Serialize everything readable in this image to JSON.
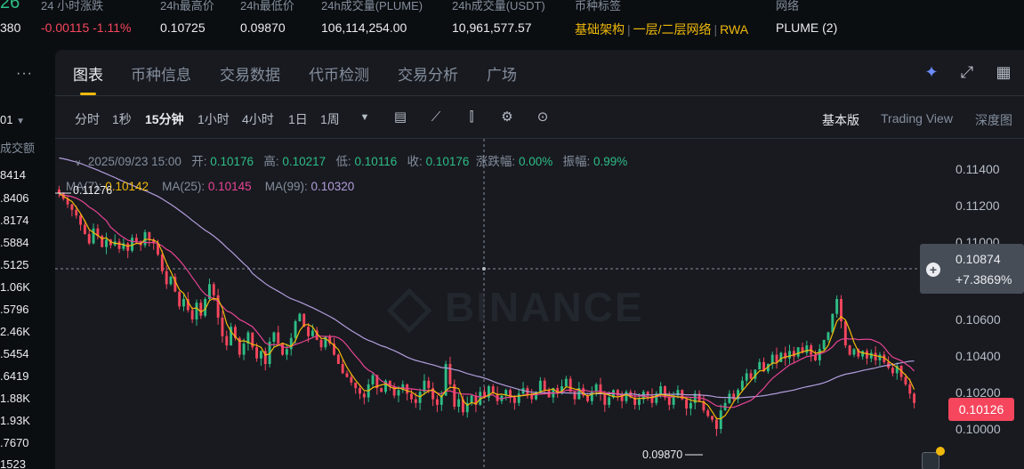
{
  "stats": {
    "price_partial": "380",
    "price_big": "26",
    "change_24h": {
      "label": "24 小时涨跌",
      "value": "-0.00115 -1.11%"
    },
    "high_24h": {
      "label": "24h最高价",
      "value": "0.10725"
    },
    "low_24h": {
      "label": "24h最低价",
      "value": "0.09870"
    },
    "vol_plume": {
      "label": "24h成交量(PLUME)",
      "value": "106,114,254.00"
    },
    "vol_usdt": {
      "label": "24h成交量(USDT)",
      "value": "10,961,577.57"
    },
    "tags": {
      "label": "币种标签",
      "items": [
        "基础架构",
        "一层/二层网络",
        "RWA"
      ]
    },
    "network": {
      "label": "网络",
      "value": "PLUME (2)"
    }
  },
  "left": {
    "dots": "···",
    "pair": "01",
    "header": "成交额",
    "rows": [
      "8414",
      ".8406",
      ".8174",
      ".5884",
      ".5125",
      "1.06K",
      ".5796",
      "2.46K",
      ".5454",
      ".6419",
      "1.88K",
      "1.93K",
      ".7670",
      "1523"
    ]
  },
  "tabs": [
    "图表",
    "币种信息",
    "交易数据",
    "代币检测",
    "交易分析",
    "广场"
  ],
  "toolbar": {
    "intervals": [
      "分时",
      "1秒",
      "15分钟",
      "1小时",
      "4小时",
      "1日",
      "1周"
    ],
    "active_interval": "15分钟",
    "views": [
      "基本版",
      "Trading View",
      "深度图"
    ]
  },
  "icons": {
    "ai": "sparkle-icon",
    "expand": "expand-icon",
    "layout": "grid-icon"
  },
  "info": {
    "date": "2025/09/23 15:00",
    "open_label": "开:",
    "open": "0.10176",
    "high_label": "高:",
    "high": "0.10217",
    "low_label": "低:",
    "low": "0.10116",
    "close_label": "收:",
    "close": "0.10176",
    "change_label": "涨跌幅:",
    "change": "0.00%",
    "amp_label": "振幅:",
    "amp": "0.99%",
    "ma7_label": "MA(7):",
    "ma7": "0.10142",
    "ma25_label": "MA(25):",
    "ma25": "0.10145",
    "ma99_label": "MA(99):",
    "ma99": "0.10320"
  },
  "chart_data": {
    "type": "candlestick",
    "y_axis_labels": [
      "0.11400",
      "0.11200",
      "0.11000",
      "0.10600",
      "0.10400",
      "0.10200",
      "0.10000"
    ],
    "ylim": [
      0.0985,
      0.115
    ],
    "crosshair_price": "0.10874",
    "crosshair_pct": "+7.3869%",
    "last_price": "0.10126",
    "high_marker": "0.11276",
    "low_marker": "0.09870",
    "watermark": "BINANCE",
    "colors": {
      "up": "#2ebd85",
      "down": "#f6465d",
      "ma7": "#f0b90b",
      "ma25": "#e84393",
      "ma99": "#b39ddb"
    },
    "close_path": [
      0.1127,
      0.1124,
      0.1121,
      0.1118,
      0.1115,
      0.111,
      0.1105,
      0.11,
      0.1108,
      0.1104,
      0.1098,
      0.1102,
      0.1099,
      0.1101,
      0.1097,
      0.11,
      0.1096,
      0.1103,
      0.1101,
      0.1099,
      0.1106,
      0.1102,
      0.11,
      0.1094,
      0.1085,
      0.1078,
      0.1082,
      0.1074,
      0.1066,
      0.107,
      0.1064,
      0.1059,
      0.1068,
      0.1061,
      0.107,
      0.1078,
      0.1072,
      0.106,
      0.105,
      0.1045,
      0.1055,
      0.1049,
      0.104,
      0.1046,
      0.1052,
      0.1044,
      0.1038,
      0.1042,
      0.1035,
      0.1047,
      0.1052,
      0.1046,
      0.104,
      0.1043,
      0.1049,
      0.1058,
      0.1062,
      0.1055,
      0.105,
      0.1053,
      0.1048,
      0.1044,
      0.105,
      0.1046,
      0.104,
      0.1035,
      0.103,
      0.1028,
      0.1025,
      0.1022,
      0.1019,
      0.1017,
      0.1024,
      0.1029,
      0.1022,
      0.102,
      0.1026,
      0.1023,
      0.1018,
      0.1021,
      0.1024,
      0.1019,
      0.1016,
      0.1014,
      0.102,
      0.1026,
      0.1022,
      0.1016,
      0.1013,
      0.1018,
      0.1035,
      0.1024,
      0.1012,
      0.1016,
      0.1009,
      0.1014,
      0.1018,
      0.1013,
      0.102,
      0.1017,
      0.1023,
      0.1019,
      0.1015,
      0.1018,
      0.1021,
      0.1017,
      0.1014,
      0.1019,
      0.1022,
      0.1018,
      0.1016,
      0.102,
      0.1026,
      0.1021,
      0.1017,
      0.1022,
      0.1019,
      0.1023,
      0.1027,
      0.102,
      0.1016,
      0.1022,
      0.1018,
      0.1015,
      0.102,
      0.1024,
      0.1019,
      0.1013,
      0.1017,
      0.1021,
      0.1018,
      0.1015,
      0.102,
      0.1017,
      0.1013,
      0.1016,
      0.102,
      0.1018,
      0.1014,
      0.1019,
      0.1023,
      0.1017,
      0.1013,
      0.1018,
      0.1021,
      0.1016,
      0.1011,
      0.1014,
      0.1019,
      0.1015,
      0.101,
      0.1007,
      0.1005,
      0.1,
      0.101,
      0.1014,
      0.1019,
      0.1016,
      0.1021,
      0.1026,
      0.103,
      0.1027,
      0.1032,
      0.1036,
      0.1031,
      0.1035,
      0.104,
      0.1036,
      0.1041,
      0.1038,
      0.1042,
      0.1039,
      0.1044,
      0.1041,
      0.1045,
      0.104,
      0.1037,
      0.1043,
      0.1048,
      0.1052,
      0.1062,
      0.107,
      0.1058,
      0.1045,
      0.104,
      0.1043,
      0.1039,
      0.1042,
      0.1038,
      0.1041,
      0.1037,
      0.104,
      0.1036,
      0.1033,
      0.103,
      0.1034,
      0.1028,
      0.1024,
      0.1019,
      0.1014
    ]
  }
}
